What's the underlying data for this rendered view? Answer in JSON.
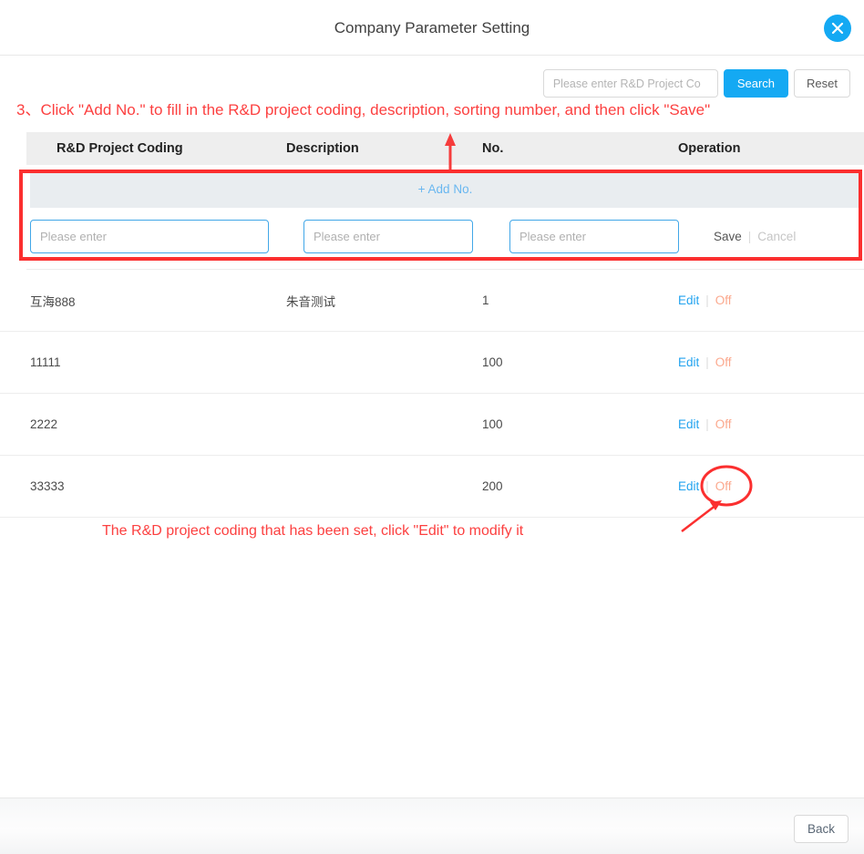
{
  "modal": {
    "title": "Company Parameter Setting",
    "close_icon": "close-circle-icon"
  },
  "search": {
    "placeholder": "Please enter R&D Project Co",
    "value": "",
    "search_label": "Search",
    "reset_label": "Reset"
  },
  "table": {
    "columns": [
      "R&D Project Coding",
      "Description",
      "No.",
      "Operation"
    ],
    "add_row_label": "+ Add No.",
    "new_row": {
      "code_placeholder": "Please enter",
      "desc_placeholder": "Please enter",
      "no_placeholder": "Please enter",
      "code_value": "",
      "desc_value": "",
      "no_value": "",
      "save_label": "Save",
      "divider": "|",
      "cancel_label": "Cancel"
    },
    "op_labels": {
      "edit": "Edit",
      "divider": "|",
      "off": "Off"
    },
    "rows": [
      {
        "code": "互海888",
        "description": "朱音测试",
        "no": "1",
        "edit": "Edit",
        "off": "Off"
      },
      {
        "code": "11111",
        "description": "",
        "no": "100",
        "edit": "Edit",
        "off": "Off"
      },
      {
        "code": "2222",
        "description": "",
        "no": "100",
        "edit": "Edit",
        "off": "Off"
      },
      {
        "code": "33333",
        "description": "",
        "no": "200",
        "edit": "Edit",
        "off": "Off"
      }
    ]
  },
  "footer": {
    "back_label": "Back"
  },
  "annotations": {
    "top": "3、Click \"Add No.\" to fill in the R&D project coding, description, sorting number, and then click \"Save\"",
    "bottom": "The R&D project coding that has been set, click \"Edit\" to modify it"
  },
  "colors": {
    "accent_blue": "#14a9f3",
    "link_blue": "#23a3ef",
    "off_orange": "#fba88d",
    "annotation_red": "#fc4040",
    "header_gray": "#eeeeee",
    "add_band_gray": "#e9edf0"
  }
}
